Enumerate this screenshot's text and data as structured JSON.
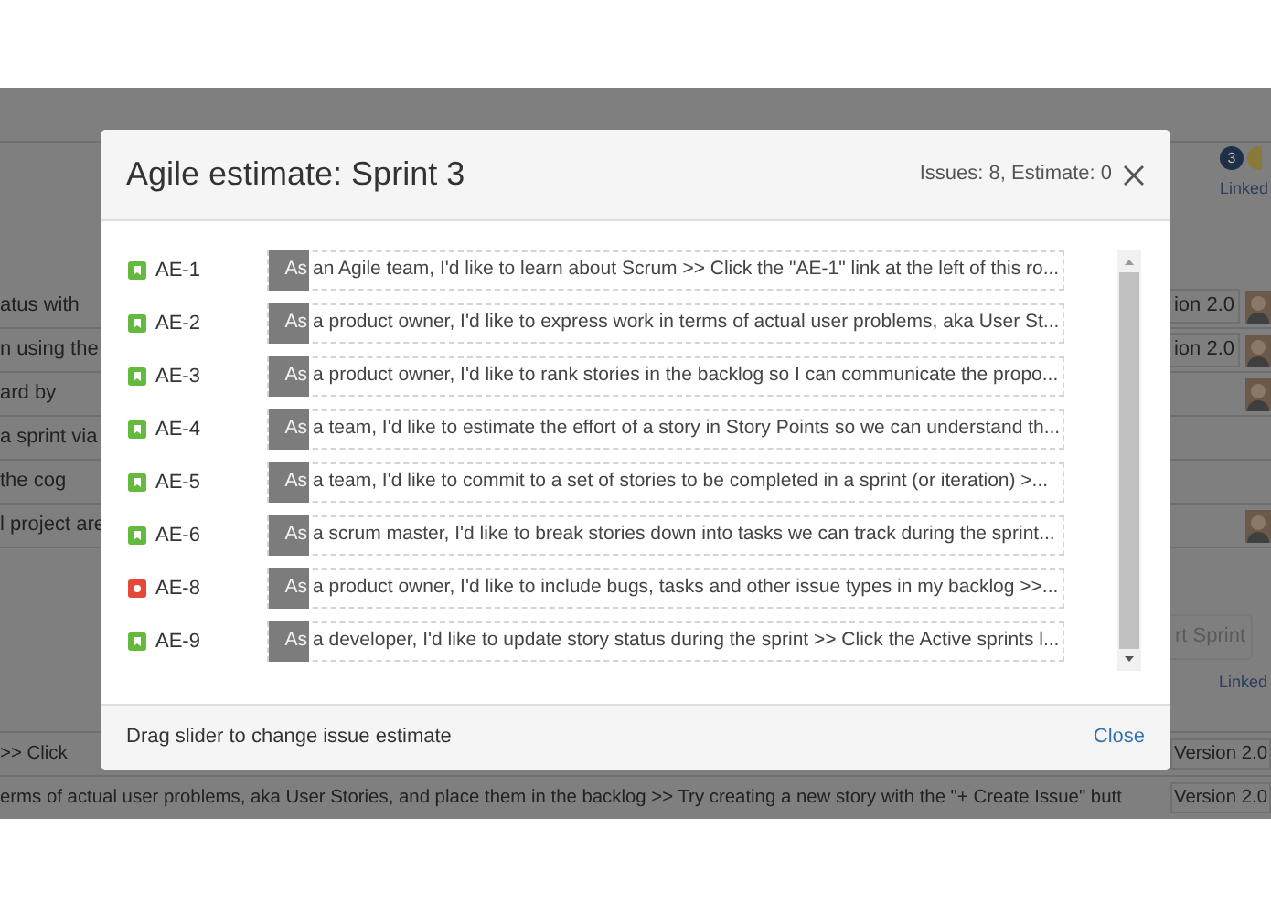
{
  "background": {
    "header_badge": "3",
    "header_link": "Linked",
    "rows": [
      {
        "fragment": "atus with",
        "version": "ion 2.0",
        "avatar": true
      },
      {
        "fragment": "n using the",
        "version": "ion 2.0",
        "avatar": true
      },
      {
        "fragment": "ard by",
        "avatar": true
      },
      {
        "fragment": "a sprint via",
        "avatar": false
      },
      {
        "fragment": "the cog",
        "avatar": false
      },
      {
        "fragment": "l project are",
        "avatar": true
      }
    ],
    "sprint_button": "rt Sprint",
    "footer_link": "Linked",
    "bottom_rows": [
      {
        "fragment": ">> Click",
        "version": "Version 2.0"
      },
      {
        "fragment": "erms of actual user problems, aka User Stories, and place them in the backlog >> Try creating a new story with the \"+ Create Issue\" butt",
        "version": "Version 2.0"
      }
    ]
  },
  "dialog": {
    "title": "Agile estimate: Sprint 3",
    "summary": "Issues: 8, Estimate: 0",
    "issues": [
      {
        "kind": "story",
        "key": "AE-1",
        "handle_text": "As",
        "summary": "an Agile team, I'd like to learn about Scrum >> Click the \"AE-1\" link at the left of this ro...",
        "level": 0
      },
      {
        "kind": "story",
        "key": "AE-2",
        "handle_text": "As",
        "summary": "a product owner, I'd like to express work in terms of actual user problems, aka User St...",
        "level": 0
      },
      {
        "kind": "story",
        "key": "AE-3",
        "handle_text": "As",
        "summary": "a product owner, I'd like to rank stories in the backlog so I can communicate the propo...",
        "level": 0
      },
      {
        "kind": "story",
        "key": "AE-4",
        "handle_text": "As",
        "summary": "a team, I'd like to estimate the effort of a story in Story Points so we can understand th...",
        "level": 0
      },
      {
        "kind": "story",
        "key": "AE-5",
        "handle_text": "As",
        "summary": "a team, I'd like to commit to a set of stories to be completed in a sprint (or iteration) >...",
        "level": 0
      },
      {
        "kind": "story",
        "key": "AE-6",
        "handle_text": "As",
        "summary": "a scrum master, I'd like to break stories down into tasks we can track during the sprint...",
        "level": 0
      },
      {
        "kind": "bug",
        "key": "AE-8",
        "handle_text": "As",
        "summary": "a product owner, I'd like to include bugs, tasks and other issue types in my backlog >>...",
        "level": 0
      },
      {
        "kind": "story",
        "key": "AE-9",
        "handle_text": "As",
        "summary": "a developer, I'd like to update story status during the sprint >> Click the Active sprints l...",
        "level": 0
      }
    ],
    "hint": "Drag slider to change issue estimate",
    "close": "Close"
  }
}
